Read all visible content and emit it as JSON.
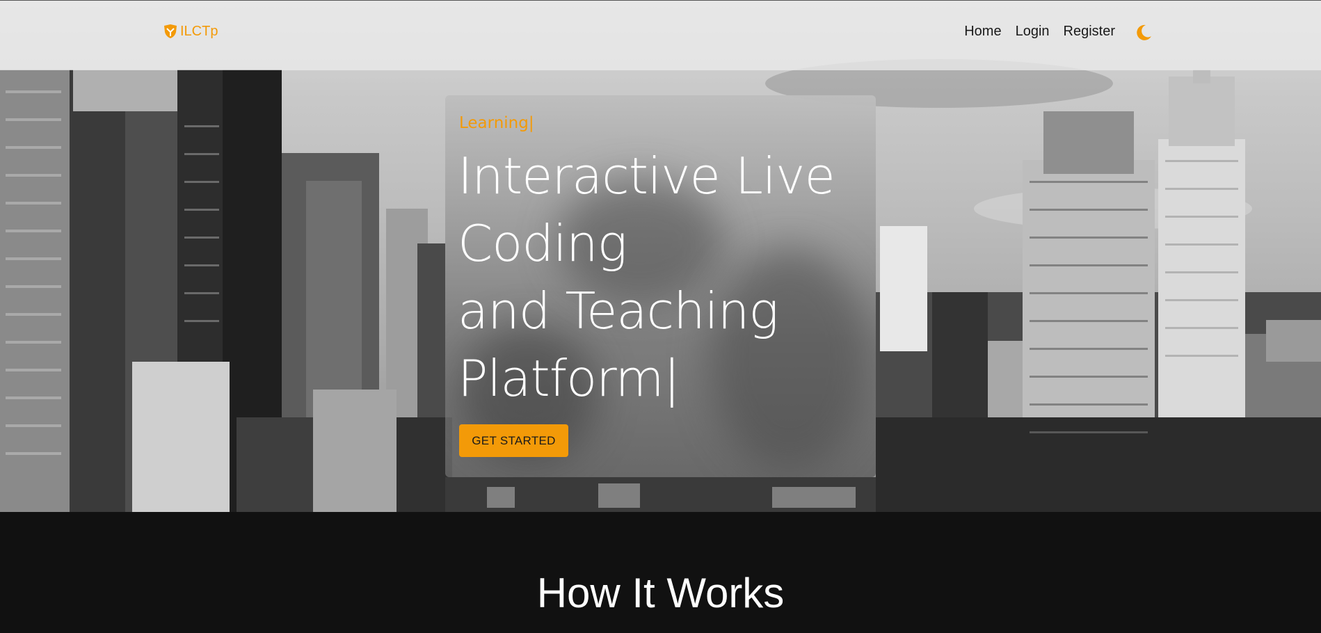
{
  "navbar": {
    "brand": "ILCTp",
    "brand_icon": "logo-shield-icon",
    "links": [
      {
        "label": "Home"
      },
      {
        "label": "Login"
      },
      {
        "label": "Register"
      }
    ],
    "theme_toggle_icon": "moon-icon"
  },
  "hero": {
    "tagline": "Learning|",
    "headline_lines": [
      "Interactive Live",
      "Coding",
      "and Teaching",
      "Platform|"
    ],
    "cta_label": "GET STARTED"
  },
  "section": {
    "title": "How It Works"
  },
  "colors": {
    "accent": "#f39a08",
    "section_bg": "#111111",
    "navbar_bg": "#ebebeb",
    "text_light": "#ffffff"
  }
}
